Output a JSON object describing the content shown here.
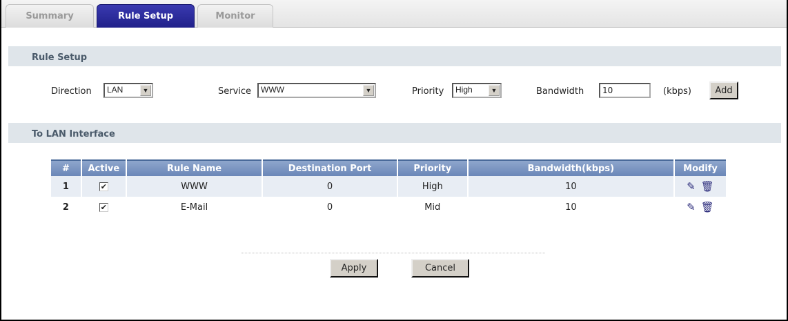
{
  "tabs": [
    {
      "label": "Summary"
    },
    {
      "label": "Rule Setup"
    },
    {
      "label": "Monitor"
    }
  ],
  "rule_setup": {
    "title": "Rule Setup",
    "direction_label": "Direction",
    "direction_value": "LAN",
    "service_label": "Service",
    "service_value": "WWW",
    "priority_label": "Priority",
    "priority_value": "High",
    "bandwidth_label": "Bandwidth",
    "bandwidth_value": "10",
    "unit": "(kbps)",
    "add_label": "Add"
  },
  "lan": {
    "title": "To LAN Interface",
    "columns": [
      "#",
      "Active",
      "Rule Name",
      "Destination Port",
      "Priority",
      "Bandwidth(kbps)",
      "Modify"
    ],
    "rows": [
      {
        "num": "1",
        "active": true,
        "name": "WWW",
        "port": "0",
        "priority": "High",
        "bandwidth": "10"
      },
      {
        "num": "2",
        "active": true,
        "name": "E-Mail",
        "port": "0",
        "priority": "Mid",
        "bandwidth": "10"
      }
    ]
  },
  "buttons": {
    "apply": "Apply",
    "cancel": "Cancel"
  }
}
